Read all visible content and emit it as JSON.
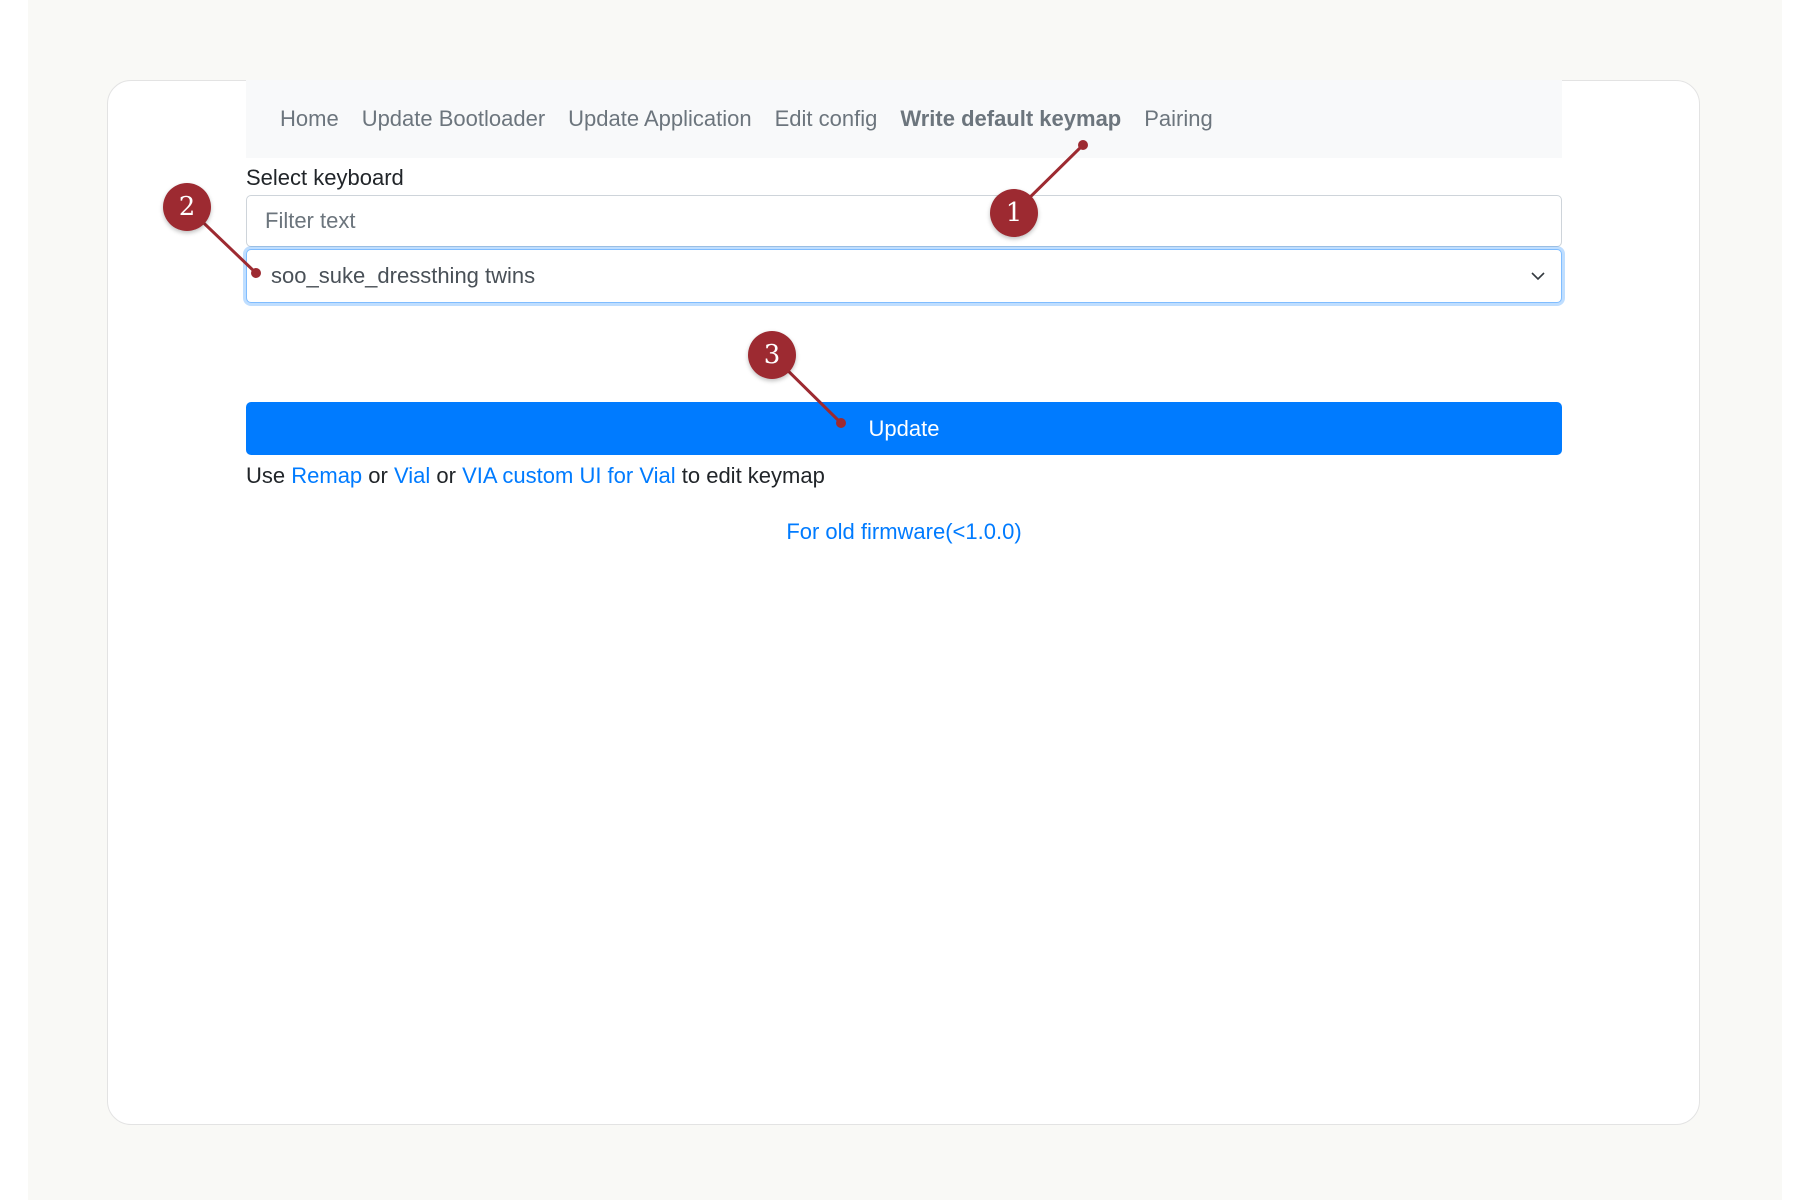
{
  "navbar": {
    "items": [
      {
        "label": "Home",
        "active": false
      },
      {
        "label": "Update Bootloader",
        "active": false
      },
      {
        "label": "Update Application",
        "active": false
      },
      {
        "label": "Edit config",
        "active": false
      },
      {
        "label": "Write default keymap",
        "active": true
      },
      {
        "label": "Pairing",
        "active": false
      }
    ]
  },
  "form": {
    "select_label": "Select keyboard",
    "filter_placeholder": "Filter text",
    "selected_keyboard": "soo_suke_dressthing twins",
    "update_label": "Update"
  },
  "hint": {
    "prefix": "Use ",
    "link_remap": "Remap",
    "sep1": " or ",
    "link_vial": "Vial",
    "sep2": " or ",
    "link_via": "VIA custom UI for Vial",
    "suffix": " to edit keymap"
  },
  "old_firmware_link": "For old firmware(<1.0.0)",
  "callouts": [
    {
      "number": "1"
    },
    {
      "number": "2"
    },
    {
      "number": "3"
    }
  ],
  "colors": {
    "accent": "#007bff",
    "callout": "#9d2a31",
    "focus_border": "#80bdff"
  }
}
